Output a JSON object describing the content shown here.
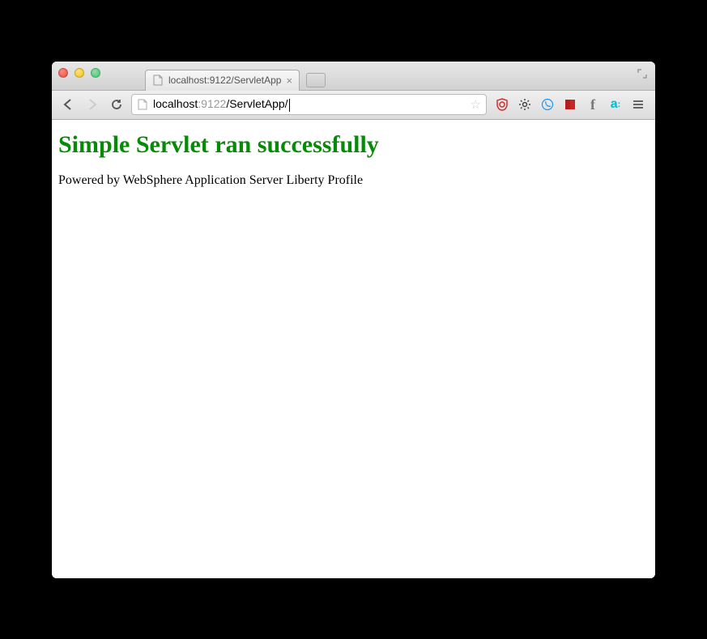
{
  "tab": {
    "title": "localhost:9122/ServletApp"
  },
  "address": {
    "host": "localhost",
    "port": ":9122",
    "path": "/ServletApp/"
  },
  "page": {
    "heading": "Simple Servlet ran successfully",
    "subtext": "Powered by WebSphere Application Server Liberty Profile"
  },
  "colors": {
    "heading_green": "#068b06"
  }
}
